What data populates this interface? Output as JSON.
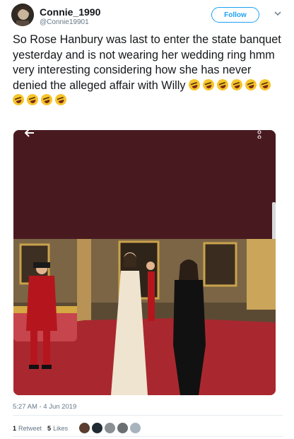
{
  "user": {
    "display_name": "Connie_1990",
    "handle": "@Connie19901",
    "follow_label": "Follow"
  },
  "tweet": {
    "text": "So Rose Hanbury was last to enter the state banquet yesterday and is not wearing her wedding ring hmm very interesting considering how she has never denied the alleged affair with Willy",
    "emoji_count": 10,
    "emoji_icon": "rolling-on-floor-laughing-emoji",
    "timestamp": "5:27 AM - 4 Jun 2019"
  },
  "stats": {
    "retweets_count": "1",
    "retweets_label": "Retweet",
    "likes_count": "5",
    "likes_label": "Likes",
    "liker_avatars": 5
  },
  "colors": {
    "brand_blue": "#1da1f2",
    "muted_text": "#657786",
    "media_top": "#481a20",
    "carpet_red": "#b02d33"
  }
}
